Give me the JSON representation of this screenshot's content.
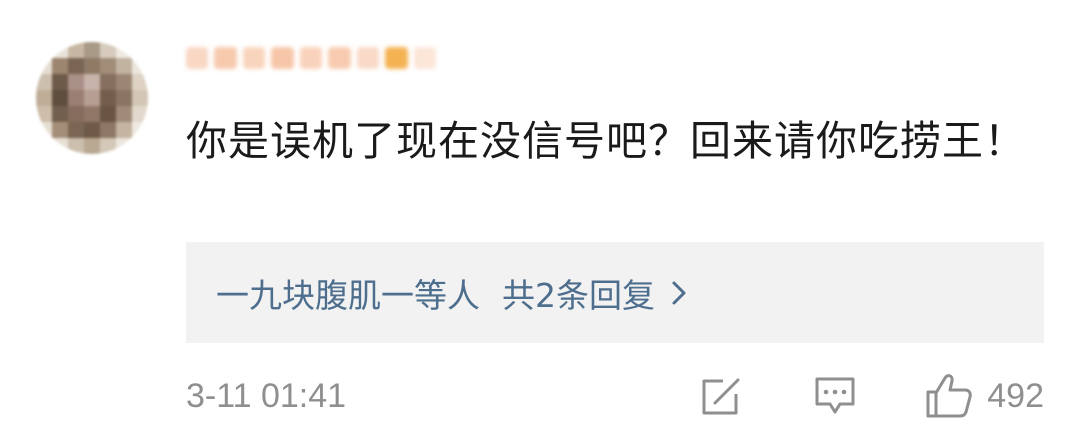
{
  "comment": {
    "text": "你是误机了现在没信号吧？回来请你吃捞王！",
    "reply_summary": {
      "replier": "一九块腹肌一等人",
      "count_label": "共2条回复"
    },
    "time": "3-11 01:41",
    "like_count": "492"
  },
  "icons": {
    "edit": "edit-icon",
    "comment": "comment-icon",
    "like": "thumbs-up-icon",
    "chevron": "chevron-right-icon"
  },
  "colors": {
    "link": "#4e6e8e",
    "muted": "#8f8f8f",
    "text": "#1a1a1a",
    "reply_bg": "#f2f2f2"
  }
}
